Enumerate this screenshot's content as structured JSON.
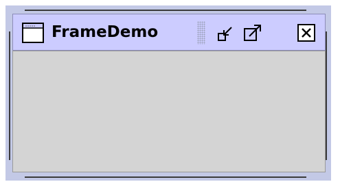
{
  "window": {
    "title": "FrameDemo"
  },
  "colors": {
    "frame_border": "#c3c9e6",
    "titlebar_bg": "#ccccff",
    "content_bg": "#d4d4d4",
    "title_text": "#000000"
  },
  "icons": {
    "app": "window-icon",
    "minimize": "minimize-icon",
    "maximize": "maximize-icon",
    "close": "close-icon",
    "grip": "title-grip"
  }
}
